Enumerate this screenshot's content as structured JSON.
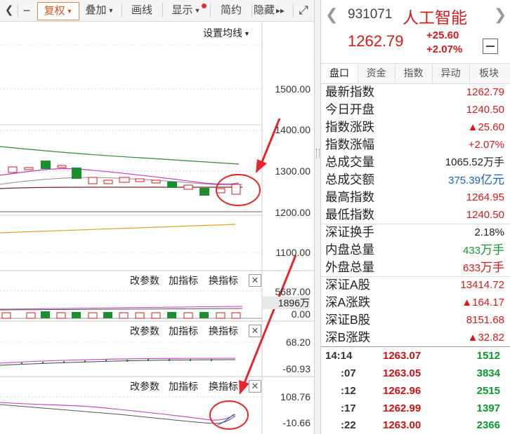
{
  "toolbar": {
    "left_arrow": "❮",
    "minus": "−",
    "fuquan": "复权",
    "diejia": "叠加",
    "huaxian": "画线",
    "xianshi": "显示",
    "jianyue": "简约",
    "yincang": "隐藏",
    "yincang_arrows": "▸▸",
    "fullscreen": "⤢"
  },
  "chart": {
    "ma_setting": "设置均线",
    "axis_main": [
      "1500.00",
      "1400.00",
      "1300.00",
      "1200.00",
      "1100.00"
    ],
    "vol_top": "5687.00",
    "vol_mid": "1896万",
    "vol_bottom": "0.00",
    "ind1_top": "68.20",
    "ind1_bottom": "-60.93",
    "ind2_top": "108.76",
    "ind2_bottom": "-10.66",
    "btn_gaicanshu": "改参数",
    "btn_jiazhibiao": "加指标",
    "btn_huanzhibiao": "换指标",
    "close_x": "✕",
    "colors": {
      "up": "#d7191c",
      "down": "#1b8f2f",
      "ma_green": "#2e8b2e",
      "ma_purple": "#c03cc0",
      "ma_dark": "#7a1f1f",
      "ma_orange": "#e0a020",
      "annotation": "#e8252a"
    }
  },
  "quote": {
    "code": "931071",
    "name": "人工智能",
    "price": "1262.79",
    "change": "+25.60",
    "change_pct": "+2.07%"
  },
  "tabs": [
    "盘口",
    "资金",
    "指数",
    "异动",
    "板块"
  ],
  "stats1": [
    {
      "label": "最新指数",
      "value": "1262.79",
      "color": "red"
    },
    {
      "label": "今日开盘",
      "value": "1240.50",
      "color": "red"
    },
    {
      "label": "指数涨跌",
      "value": "▲25.60",
      "color": "red"
    },
    {
      "label": "指数涨幅",
      "value": "+2.07%",
      "color": "red"
    },
    {
      "label": "总成交量",
      "value": "1065.52万手",
      "color": "black"
    },
    {
      "label": "总成交额",
      "value": "375.39",
      "unit": "亿元",
      "color": "blue"
    },
    {
      "label": "最高指数",
      "value": "1264.95",
      "color": "red"
    },
    {
      "label": "最低指数",
      "value": "1240.50",
      "color": "red"
    }
  ],
  "stats2": [
    {
      "label": "深证换手",
      "value": "2.18%",
      "color": "black"
    },
    {
      "label": "内盘总量",
      "value": "433",
      "unit": "万手",
      "color": "green"
    },
    {
      "label": "外盘总量",
      "value": "633",
      "unit": "万手",
      "color": "red"
    }
  ],
  "stats3": [
    {
      "label": "深证A股",
      "value": "13414.72",
      "color": "red"
    },
    {
      "label": "深A涨跌",
      "value": "▲164.17",
      "color": "red"
    },
    {
      "label": "深证B股",
      "value": "8151.68",
      "color": "red"
    },
    {
      "label": "深B涨跌",
      "value": "▲32.82",
      "color": "red"
    }
  ],
  "ticks": [
    {
      "time": "14:14",
      "price": "1263.07",
      "vol": "1512"
    },
    {
      "time": ":07",
      "price": "1263.05",
      "vol": "3834"
    },
    {
      "time": ":12",
      "price": "1262.96",
      "vol": "2515"
    },
    {
      "time": ":17",
      "price": "1262.99",
      "vol": "1397"
    },
    {
      "time": ":22",
      "price": "1263.00",
      "vol": "2366"
    }
  ]
}
